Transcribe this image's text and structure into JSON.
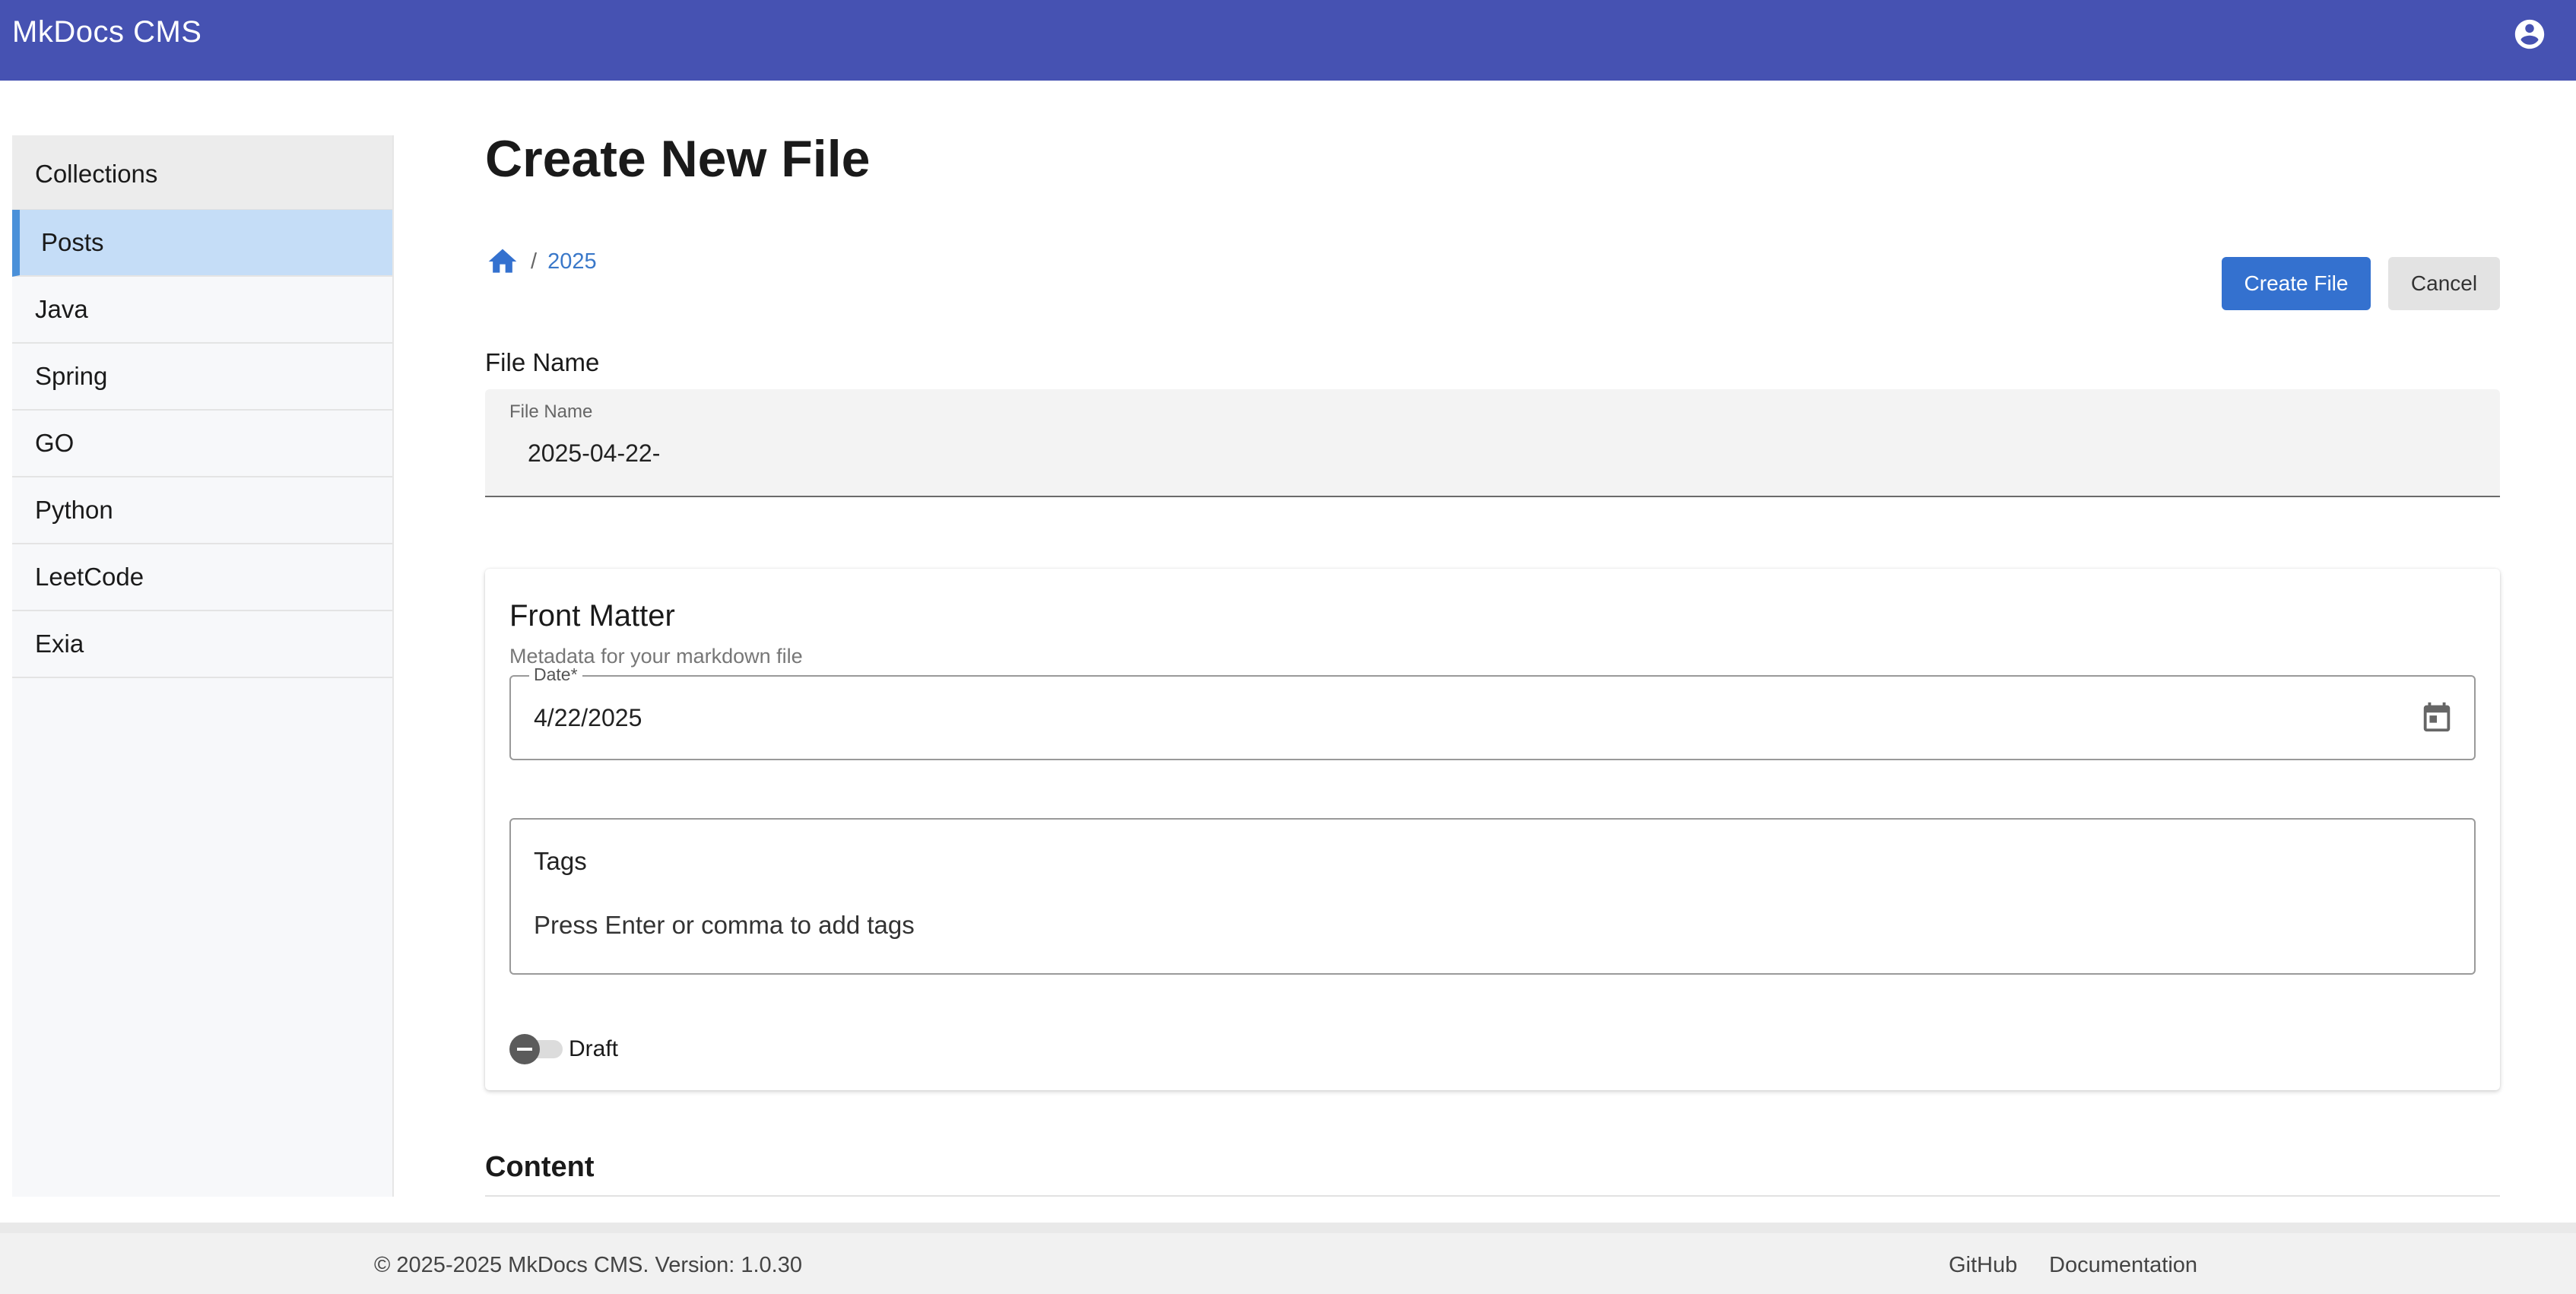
{
  "app": {
    "title": "MkDocs CMS",
    "accent": "#4652b2"
  },
  "sidebar": {
    "header": "Collections",
    "items": [
      {
        "label": "Posts",
        "active": true
      },
      {
        "label": "Java"
      },
      {
        "label": "Spring"
      },
      {
        "label": "GO"
      },
      {
        "label": "Python"
      },
      {
        "label": "LeetCode"
      },
      {
        "label": "Exia"
      }
    ]
  },
  "page": {
    "title": "Create New File",
    "breadcrumb": {
      "home_icon": "home-icon",
      "separator": "/",
      "current": "2025"
    },
    "create_label": "Create File",
    "cancel_label": "Cancel",
    "file_name_section": "File Name",
    "file_name_label": "File Name",
    "file_name_value": "2025-04-22-"
  },
  "front_matter": {
    "title": "Front Matter",
    "subtitle": "Metadata for your markdown file",
    "date_label": "Date*",
    "date_value": "4/22/2025",
    "tags_label": "Tags",
    "tags_placeholder": "Press Enter or comma to add tags",
    "draft_label": "Draft"
  },
  "content": {
    "title": "Content"
  },
  "footer": {
    "copyright": "© 2025-2025 MkDocs CMS. Version: 1.0.30",
    "github": "GitHub",
    "docs": "Documentation"
  }
}
